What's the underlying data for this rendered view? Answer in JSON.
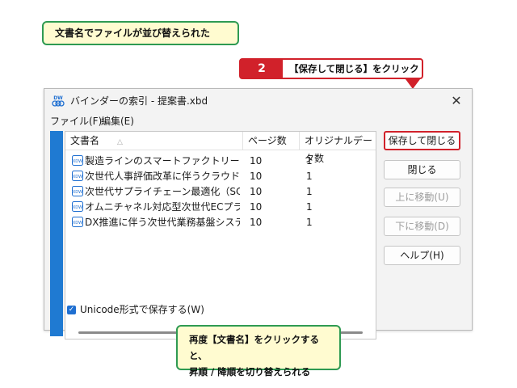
{
  "callout_top": "文書名でファイルが並び替えられた",
  "step": {
    "number": "2",
    "text": "【保存して閉じる】をクリック"
  },
  "callout_bottom": {
    "line1": "再度【文書名】をクリックすると、",
    "line2": "昇順 / 降順を切り替えられる"
  },
  "window": {
    "title": "バインダーの索引 - 提案書.xbd",
    "app_icon": "dw-binder-icon",
    "close": "✕",
    "menu": [
      "ファイル(F)",
      "編集(E)"
    ],
    "columns": [
      "文書名",
      "ページ数",
      "オリジナルデータ数"
    ],
    "sort_indicator": "△",
    "rows": [
      {
        "name": "製造ラインのスマートファクトリー化に伴う...",
        "pages": "10",
        "originals": "1"
      },
      {
        "name": "次世代人事評価改革に伴うクラウド型...",
        "pages": "10",
        "originals": "1"
      },
      {
        "name": "次世代サプライチェーン最適化（SCM...",
        "pages": "10",
        "originals": "1"
      },
      {
        "name": "オムニチャネル対応型次世代ECプラット...",
        "pages": "10",
        "originals": "1"
      },
      {
        "name": "DX推進に伴う次世代業務基盤システ...",
        "pages": "10",
        "originals": "1"
      }
    ],
    "buttons": {
      "save_close": "保存して閉じる",
      "close": "閉じる",
      "move_up": "上に移動(U)",
      "move_down": "下に移動(D)",
      "help": "ヘルプ(H)"
    },
    "unicode_checkbox": {
      "label": "Unicode形式で保存する(W)",
      "checked": true
    },
    "accent_color": "#1f7ad2"
  },
  "highlight_color": "#d1212a",
  "callout_border_color": "#2e9a52"
}
